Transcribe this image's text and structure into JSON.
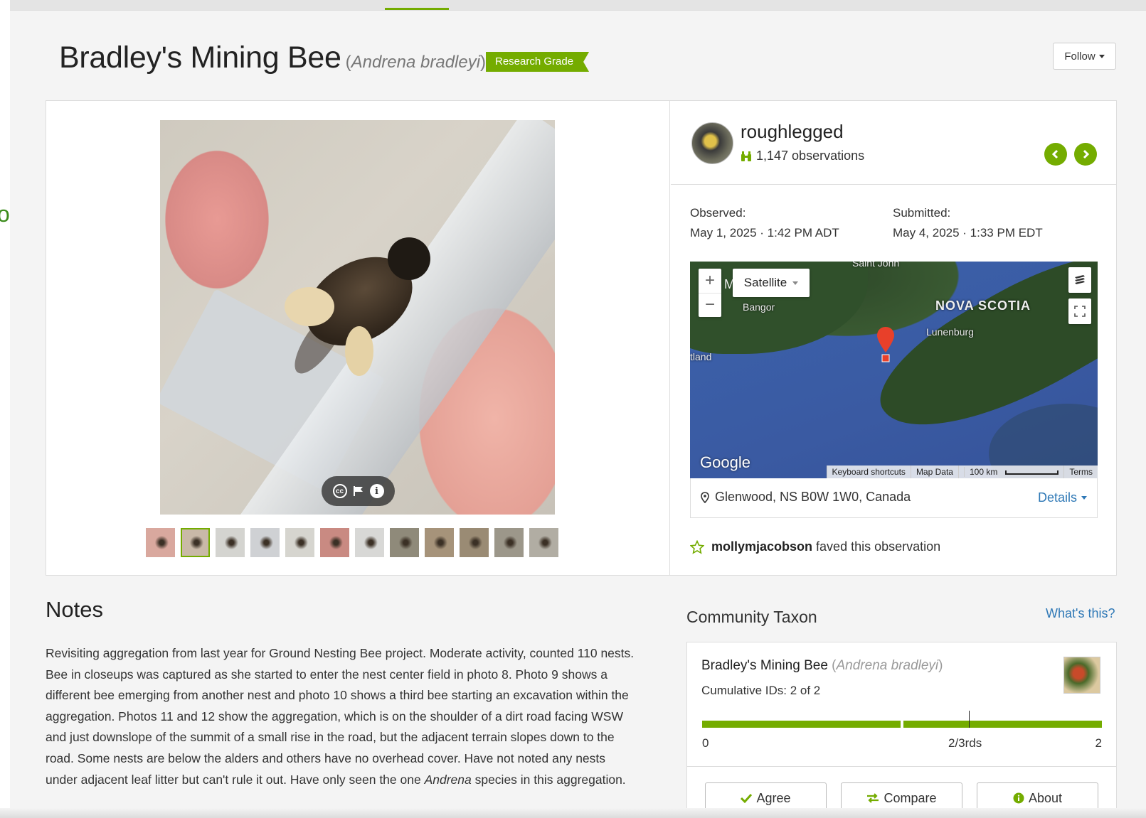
{
  "header": {
    "common_name": "Bradley's Mining Bee",
    "sci_open": "(",
    "sci_name": "Andrena bradleyi",
    "sci_close": ")",
    "quality_badge": "Research Grade",
    "follow_label": "Follow",
    "left_edge_fragment": "o"
  },
  "photos": {
    "thumbnail_count": 12,
    "selected_index": 1,
    "thumbnail_colors": [
      "#d9a89e",
      "#c9b9a8",
      "#d4d4d0",
      "#cfd1d4",
      "#d6d5cf",
      "#c98a82",
      "#d8d8d6",
      "#8f8a7a",
      "#a6937a",
      "#9a8b74",
      "#9c978a",
      "#b1ada3"
    ]
  },
  "observer": {
    "username": "roughlegged",
    "observations_count": "1,147 observations"
  },
  "dates": {
    "observed_label": "Observed:",
    "observed_value": "May 1, 2025 · 1:42 PM ADT",
    "submitted_label": "Submitted:",
    "submitted_value": "May 4, 2025 · 1:33 PM EDT"
  },
  "map": {
    "type_label": "Satellite",
    "zoom_in": "+",
    "zoom_out": "−",
    "labels": {
      "saint_john": "Saint John",
      "bangor": "Bangor",
      "nova_scotia": "NOVA SCOTIA",
      "lunenburg": "Lunenburg",
      "portland": "tland",
      "m_fragment": "M"
    },
    "google": "Google",
    "footer": {
      "keyboard": "Keyboard shortcuts",
      "map_data": "Map Data",
      "scale": "100 km",
      "terms": "Terms"
    },
    "pin_color": "#e8402a"
  },
  "location": {
    "text": "Glenwood, NS B0W 1W0, Canada",
    "details_label": "Details"
  },
  "fave": {
    "user": "mollymjacobson",
    "text": "faved this observation"
  },
  "notes": {
    "title": "Notes",
    "body_before": "Revisiting aggregation from last year for Ground Nesting Bee project. Moderate activity, counted 110 nests. Bee in closeups was captured as she started to enter the nest center field in photo 8. Photo 9 shows a different bee emerging from another nest and photo 10 shows a third bee starting an excavation within the aggregation. Photos 11 and 12 show the aggregation, which is on the shoulder of a dirt road facing WSW and just downslope of the summit of a small rise in the road, but the adjacent terrain slopes down to the road. Some nests are below the alders and others have no overhead cover. Have not noted any nests under adjacent leaf litter but can't rule it out. Have only seen the one ",
    "body_italic": "Andrena",
    "body_after": " species in this aggregation."
  },
  "community_taxon": {
    "title": "Community Taxon",
    "whats_this": "What's this?",
    "common_name": "Bradley's Mining Bee",
    "sci_open": "(",
    "sci_name": "Andrena bradleyi",
    "sci_close": ")",
    "cumulative": "Cumulative IDs: 2 of 2",
    "agreeing_ids": 2,
    "total_ids": 2,
    "threshold_fraction": 0.6667,
    "scale_min": "0",
    "scale_mid": "2/3rds",
    "scale_max": "2",
    "agree_label": "Agree",
    "compare_label": "Compare",
    "about_label": "About"
  },
  "colors": {
    "accent_green": "#74ac00",
    "link_blue": "#2e78b6"
  }
}
